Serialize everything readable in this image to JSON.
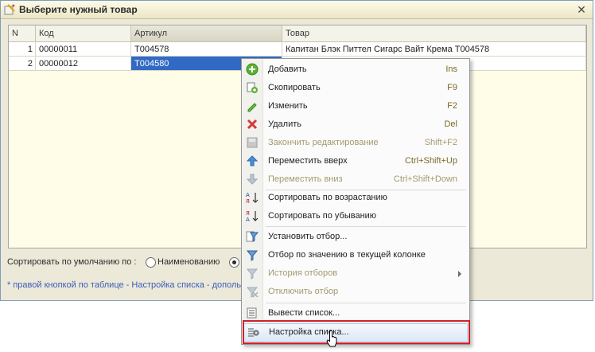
{
  "window": {
    "title": "Выберите нужный товар"
  },
  "table": {
    "columns": [
      "N",
      "Код",
      "Артикул",
      "Товар"
    ],
    "rows": [
      {
        "n": "1",
        "code": "00000011",
        "article": "T004578",
        "product": "Капитан Блэк Питтел Сигарс Вайт Крема T004578"
      },
      {
        "n": "2",
        "code": "00000012",
        "article": "T004580",
        "product": ""
      }
    ]
  },
  "sort": {
    "label": "Сортировать по умолчанию по :",
    "option_name": "Наименованию",
    "selected": "second"
  },
  "hint": "* правой кнопкой по таблице - Настройка списка - дополь",
  "menu": {
    "items": [
      {
        "label": "Добавить",
        "shortcut": "Ins",
        "icon": "add-icon",
        "disabled": false
      },
      {
        "label": "Скопировать",
        "shortcut": "F9",
        "icon": "copy-icon",
        "disabled": false
      },
      {
        "label": "Изменить",
        "shortcut": "F2",
        "icon": "edit-icon",
        "disabled": false
      },
      {
        "label": "Удалить",
        "shortcut": "Del",
        "icon": "delete-icon",
        "disabled": false
      },
      {
        "label": "Закончить редактирование",
        "shortcut": "Shift+F2",
        "icon": "save-icon",
        "disabled": true
      },
      {
        "label": "Переместить вверх",
        "shortcut": "Ctrl+Shift+Up",
        "icon": "move-up-icon",
        "disabled": false
      },
      {
        "label": "Переместить вниз",
        "shortcut": "Ctrl+Shift+Down",
        "icon": "move-down-icon",
        "disabled": true
      },
      {
        "label": "Сортировать по возрастанию",
        "shortcut": "",
        "icon": "sort-asc-icon",
        "disabled": false
      },
      {
        "label": "Сортировать по убыванию",
        "shortcut": "",
        "icon": "sort-desc-icon",
        "disabled": false
      },
      {
        "label": "Установить отбор...",
        "shortcut": "",
        "icon": "filter-set-icon",
        "disabled": false
      },
      {
        "label": "Отбор по значению в текущей колонке",
        "shortcut": "",
        "icon": "filter-value-icon",
        "disabled": false
      },
      {
        "label": "История отборов",
        "shortcut": "",
        "icon": "filter-history-icon",
        "disabled": true
      },
      {
        "label": "Отключить отбор",
        "shortcut": "",
        "icon": "filter-off-icon",
        "disabled": true
      },
      {
        "label": "Вывести список...",
        "shortcut": "",
        "icon": "print-list-icon",
        "disabled": false
      },
      {
        "label": "Настройка списка...",
        "shortcut": "",
        "icon": "list-settings-icon",
        "disabled": false
      }
    ]
  },
  "colors": {
    "selection": "#316ac5",
    "highlight_border": "#d0202a",
    "dialog_bg": "#ece9d8"
  }
}
